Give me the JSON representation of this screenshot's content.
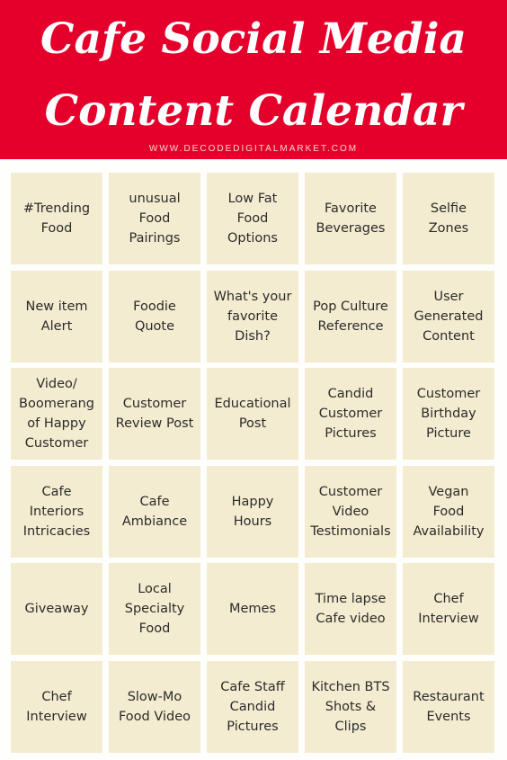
{
  "header": {
    "title_line1": "Cafe Social Media",
    "title_line2": "Content Calendar",
    "website": "WWW.DECODEDIGITALMARKET.COM"
  },
  "colors": {
    "header_bg": "#e4002b",
    "cell_bg": "#f4ecd0",
    "text": "#2b2b2b"
  },
  "calendar": {
    "cells": [
      "#Trending\nFood",
      "unusual\nFood\nPairings",
      "Low Fat\nFood\nOptions",
      "Favorite\nBeverages",
      "Selfie\nZones",
      "New item\nAlert",
      "Foodie\nQuote",
      "What's your\nfavorite\nDish?",
      "Pop Culture\nReference",
      "User\nGenerated\nContent",
      "Video/\nBoomerang\nof Happy\nCustomer",
      "Customer\nReview Post",
      "Educational\nPost",
      "Candid\nCustomer\nPictures",
      "Customer\nBirthday\nPicture",
      "Cafe\nInteriors\nIntricacies",
      "Cafe\nAmbiance",
      "Happy\nHours",
      "Customer\nVideo\nTestimonials",
      "Vegan\nFood\nAvailability",
      "Giveaway",
      "Local\nSpecialty\nFood",
      "Memes",
      "Time lapse\nCafe video",
      "Chef\nInterview",
      "Chef\nInterview",
      "Slow-Mo\nFood Video",
      "Cafe Staff\nCandid\nPictures",
      "Kitchen BTS\nShots &\nClips",
      "Restaurant\nEvents"
    ]
  }
}
